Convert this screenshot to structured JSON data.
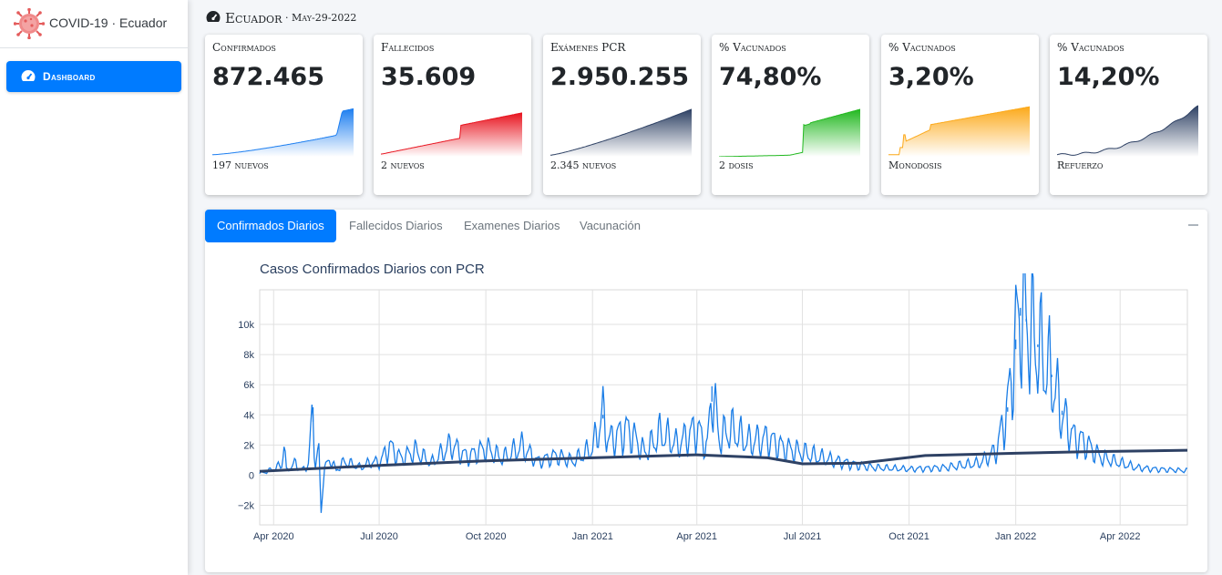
{
  "app": {
    "brand": "COVID-19 · Ecuador",
    "nav": [
      {
        "label": "Dashboard",
        "icon": "gauge-icon"
      }
    ]
  },
  "header": {
    "icon": "gauge-icon",
    "title": "Ecuador",
    "date": "· May-29-2022"
  },
  "colors": {
    "primary": "#007bff",
    "confirmados": "#1e7ff0",
    "fallecidos": "#e8141f",
    "examenes": "#2e4164",
    "vacunados": "#22b820",
    "monodosis": "#fca91a",
    "refuerzo": "#2e4164",
    "daily_line": "#1a7de6",
    "trend_line": "#2e4164"
  },
  "cards": [
    {
      "title": "Confirmados",
      "value": "872.465",
      "foot": "197 nuevos",
      "color": "#1e7ff0",
      "spark": "conf"
    },
    {
      "title": "Fallecidos",
      "value": "35.609",
      "foot": "2 nuevos",
      "color": "#e8141f",
      "spark": "fall"
    },
    {
      "title": "Exámenes PCR",
      "value": "2.950.255",
      "foot": "2.345 nuevos",
      "color": "#2e4164",
      "spark": "pcr"
    },
    {
      "title": "% Vacunados",
      "value": "74,80%",
      "foot": "2 dosis",
      "color": "#22b820",
      "spark": "vac"
    },
    {
      "title": "% Vacunados",
      "value": "3,20%",
      "foot": "Monodosis",
      "color": "#fca91a",
      "spark": "mono"
    },
    {
      "title": "% Vacunados",
      "value": "14,20%",
      "foot": "Refuerzo",
      "color": "#2e4164",
      "spark": "ref"
    }
  ],
  "tabs": [
    {
      "label": "Confirmados Diarios",
      "active": true
    },
    {
      "label": "Fallecidos Diarios",
      "active": false
    },
    {
      "label": "Examenes Diarios",
      "active": false
    },
    {
      "label": "Vacunación",
      "active": false
    }
  ],
  "chart_data": {
    "type": "line",
    "title": "Casos Confirmados Diarios con PCR",
    "xlabel": "",
    "ylabel": "",
    "x_ticks": [
      "Apr 2020",
      "Jul 2020",
      "Oct 2020",
      "Jan 2021",
      "Apr 2021",
      "Jul 2021",
      "Oct 2021",
      "Jan 2022",
      "Apr 2022"
    ],
    "y_ticks": [
      "−2k",
      "0",
      "2k",
      "4k",
      "6k",
      "8k",
      "10k"
    ],
    "ylim": [
      -3300,
      12300
    ],
    "xlim": [
      "2020-03-20",
      "2022-05-29"
    ],
    "grid": true,
    "series": [
      {
        "name": "",
        "points": [
          [
            "2020-03-20",
            100
          ],
          [
            "2020-04-01",
            400
          ],
          [
            "2020-04-08",
            700
          ],
          [
            "2020-04-10",
            2200
          ],
          [
            "2020-04-12",
            300
          ],
          [
            "2020-04-20",
            800
          ],
          [
            "2020-04-25",
            300
          ],
          [
            "2020-05-01",
            700
          ],
          [
            "2020-05-05",
            4500
          ],
          [
            "2020-05-07",
            600
          ],
          [
            "2020-05-10",
            1700
          ],
          [
            "2020-05-12",
            -2500
          ],
          [
            "2020-05-15",
            500
          ],
          [
            "2020-05-20",
            1100
          ],
          [
            "2020-05-25",
            300
          ],
          [
            "2020-06-01",
            900
          ],
          [
            "2020-06-15",
            500
          ],
          [
            "2020-06-25",
            900
          ],
          [
            "2020-07-01",
            800
          ],
          [
            "2020-07-10",
            1900
          ],
          [
            "2020-07-20",
            1100
          ],
          [
            "2020-08-01",
            1600
          ],
          [
            "2020-08-15",
            800
          ],
          [
            "2020-09-01",
            2000
          ],
          [
            "2020-09-15",
            1200
          ],
          [
            "2020-10-01",
            1800
          ],
          [
            "2020-10-15",
            1100
          ],
          [
            "2020-11-01",
            1900
          ],
          [
            "2020-11-15",
            900
          ],
          [
            "2020-12-01",
            1300
          ],
          [
            "2020-12-15",
            900
          ],
          [
            "2021-01-01",
            1800
          ],
          [
            "2021-01-10",
            4000
          ],
          [
            "2021-01-15",
            2300
          ],
          [
            "2021-02-01",
            3000
          ],
          [
            "2021-02-15",
            1500
          ],
          [
            "2021-03-01",
            2800
          ],
          [
            "2021-03-15",
            2000
          ],
          [
            "2021-04-01",
            3100
          ],
          [
            "2021-04-10",
            1800
          ],
          [
            "2021-04-14",
            5900
          ],
          [
            "2021-04-20",
            2500
          ],
          [
            "2021-05-01",
            3000
          ],
          [
            "2021-05-15",
            2200
          ],
          [
            "2021-06-01",
            2400
          ],
          [
            "2021-06-15",
            1800
          ],
          [
            "2021-07-01",
            1500
          ],
          [
            "2021-07-15",
            1200
          ],
          [
            "2021-08-01",
            900
          ],
          [
            "2021-08-15",
            700
          ],
          [
            "2021-09-01",
            500
          ],
          [
            "2021-10-01",
            400
          ],
          [
            "2021-11-01",
            500
          ],
          [
            "2021-12-01",
            800
          ],
          [
            "2021-12-15",
            1600
          ],
          [
            "2021-12-25",
            4500
          ],
          [
            "2022-01-01",
            9000
          ],
          [
            "2022-01-05",
            11100
          ],
          [
            "2022-01-10",
            10200
          ],
          [
            "2022-01-20",
            8500
          ],
          [
            "2022-02-01",
            6500
          ],
          [
            "2022-02-10",
            4000
          ],
          [
            "2022-02-20",
            2500
          ],
          [
            "2022-03-01",
            2200
          ],
          [
            "2022-03-15",
            1200
          ],
          [
            "2022-04-01",
            800
          ],
          [
            "2022-04-15",
            500
          ],
          [
            "2022-05-01",
            400
          ],
          [
            "2022-05-29",
            300
          ]
        ]
      },
      {
        "name": "",
        "points": [
          [
            "2020-03-20",
            250
          ],
          [
            "2020-07-01",
            650
          ],
          [
            "2020-10-01",
            950
          ],
          [
            "2021-01-01",
            1150
          ],
          [
            "2021-04-01",
            1350
          ],
          [
            "2021-06-01",
            1150
          ],
          [
            "2021-07-01",
            750
          ],
          [
            "2021-08-20",
            800
          ],
          [
            "2021-10-15",
            1300
          ],
          [
            "2022-01-01",
            1450
          ],
          [
            "2022-03-01",
            1550
          ],
          [
            "2022-05-29",
            1650
          ]
        ]
      }
    ]
  }
}
